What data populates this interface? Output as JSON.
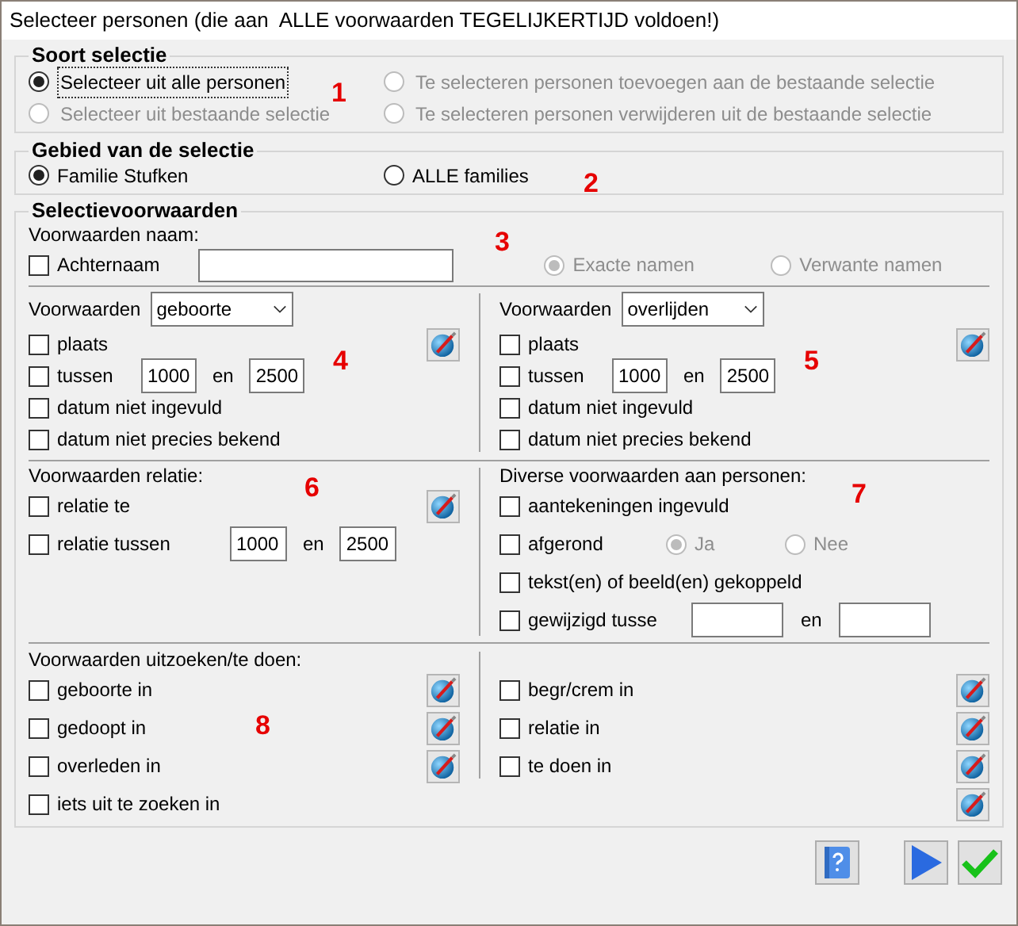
{
  "window": {
    "title": "Selecteer personen (die aan  ALLE voorwaarden TEGELIJKERTIJD voldoen!)"
  },
  "soort_selectie": {
    "title": "Soort selectie",
    "marker": "1",
    "options": [
      {
        "label": "Selecteer uit alle personen",
        "selected": true,
        "disabled": false,
        "focused": true
      },
      {
        "label": "Te selecteren personen toevoegen aan de bestaande selectie",
        "selected": false,
        "disabled": true,
        "focused": false
      },
      {
        "label": "Selecteer uit bestaande selectie",
        "selected": false,
        "disabled": true,
        "focused": false
      },
      {
        "label": "Te selecteren personen verwijderen uit de bestaande selectie",
        "selected": false,
        "disabled": true,
        "focused": false
      }
    ]
  },
  "gebied": {
    "title": "Gebied van de selectie",
    "marker": "2",
    "options": [
      {
        "label": "Familie Stufken",
        "selected": true
      },
      {
        "label": "ALLE families",
        "selected": false
      }
    ]
  },
  "selectievoorwaarden": {
    "title": "Selectievoorwaarden",
    "naam": {
      "heading": "Voorwaarden naam:",
      "marker": "3",
      "checkbox": {
        "label": "Achternaam",
        "checked": false
      },
      "options": [
        {
          "label": "Exacte namen",
          "selected": true,
          "disabled": true
        },
        {
          "label": "Verwante namen",
          "selected": false,
          "disabled": true
        }
      ]
    },
    "events": [
      {
        "label": "Voorwaarden",
        "dropdown": "geboorte",
        "marker": "4",
        "rows": [
          {
            "kind": "check",
            "label": "plaats",
            "checked": false,
            "button": true
          },
          {
            "kind": "range",
            "label": "tussen",
            "checked": false,
            "from": "1000",
            "joiner": "en",
            "to": "2500"
          },
          {
            "kind": "check",
            "label": "datum niet ingevuld",
            "checked": false,
            "button": false
          },
          {
            "kind": "check",
            "label": "datum niet precies bekend",
            "checked": false,
            "button": false
          }
        ]
      },
      {
        "label": "Voorwaarden",
        "dropdown": "overlijden",
        "marker": "5",
        "rows": [
          {
            "kind": "check",
            "label": "plaats",
            "checked": false,
            "button": true
          },
          {
            "kind": "range",
            "label": "tussen",
            "checked": false,
            "from": "1000",
            "joiner": "en",
            "to": "2500"
          },
          {
            "kind": "check",
            "label": "datum niet ingevuld",
            "checked": false,
            "button": false
          },
          {
            "kind": "check",
            "label": "datum niet precies bekend",
            "checked": false,
            "button": false
          }
        ]
      }
    ],
    "relatie": {
      "heading": "Voorwaarden relatie:",
      "marker": "6",
      "rows": [
        {
          "kind": "check",
          "label": "relatie te",
          "checked": false,
          "button": true
        },
        {
          "kind": "range",
          "label": "relatie tussen",
          "checked": false,
          "from": "1000",
          "joiner": "en",
          "to": "2500"
        }
      ]
    },
    "diverse": {
      "heading": "Diverse voorwaarden aan personen:",
      "marker": "7",
      "rows": [
        {
          "kind": "check",
          "label": "aantekeningen ingevuld",
          "checked": false,
          "button": false
        },
        {
          "kind": "choice",
          "label": "afgerond",
          "checked": false,
          "options": [
            {
              "label": "Ja",
              "selected": true,
              "disabled": true
            },
            {
              "label": "Nee",
              "selected": false,
              "disabled": true
            }
          ]
        },
        {
          "kind": "check",
          "label": "tekst(en) of beeld(en) gekoppeld",
          "checked": false,
          "button": false
        },
        {
          "kind": "range",
          "label": "gewijzigd tusse",
          "checked": false,
          "joiner": "en"
        }
      ]
    },
    "uitzoeken": {
      "heading": "Voorwaarden uitzoeken/te doen:",
      "marker": "8",
      "left": [
        {
          "kind": "check",
          "label": "geboorte in",
          "checked": false,
          "button": true
        },
        {
          "kind": "check",
          "label": "gedoopt in",
          "checked": false,
          "button": true
        },
        {
          "kind": "check",
          "label": "overleden in",
          "checked": false,
          "button": true
        },
        {
          "kind": "check",
          "label": "iets uit te zoeken in",
          "checked": false,
          "button": false
        }
      ],
      "right": [
        {
          "kind": "check",
          "label": "begr/crem in",
          "checked": false,
          "button": true
        },
        {
          "kind": "check",
          "label": "relatie in",
          "checked": false,
          "button": true
        },
        {
          "kind": "check",
          "label": "te doen in",
          "checked": false,
          "button": true
        },
        {
          "kind": "button"
        }
      ]
    }
  },
  "buttons": [
    {
      "kind": "help"
    },
    {
      "kind": "next"
    },
    {
      "kind": "ok"
    }
  ]
}
